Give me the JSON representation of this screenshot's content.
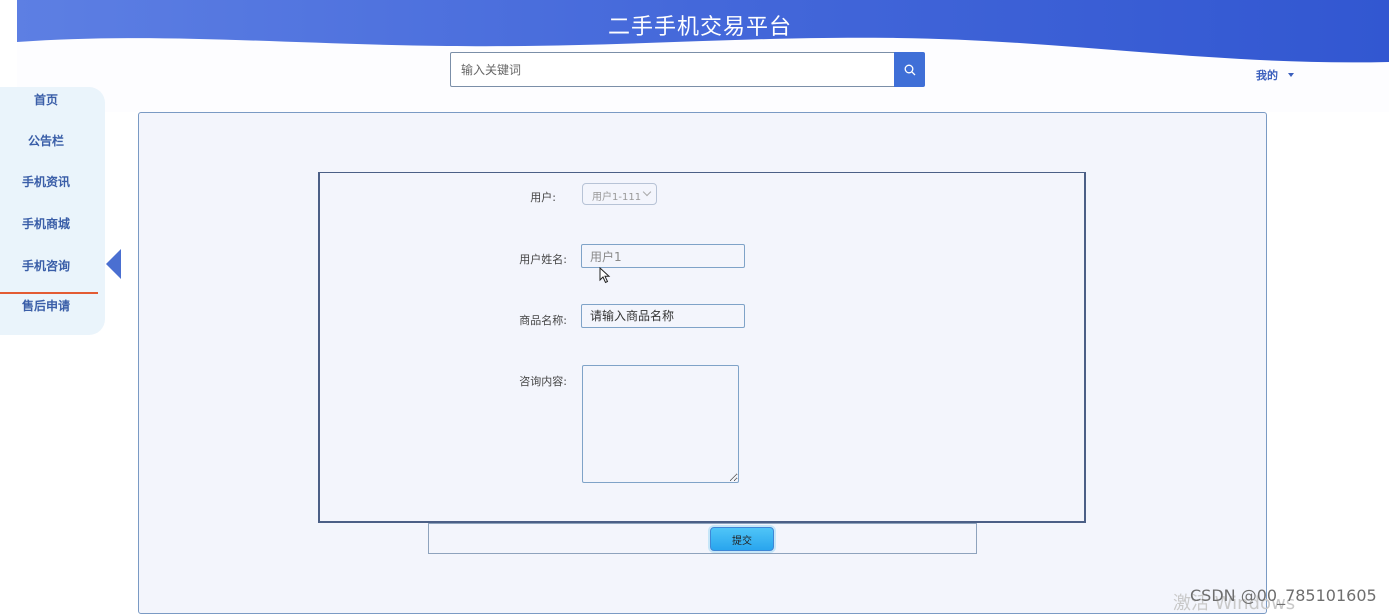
{
  "header": {
    "title": "二手手机交易平台",
    "search_placeholder": "输入关键词",
    "user_menu_label": "我的",
    "colors": {
      "wave_start": "#3a63d6",
      "wave_end": "#6f8fe8",
      "accent": "#3f6fd7"
    }
  },
  "sidebar": {
    "items": [
      {
        "label": "首页"
      },
      {
        "label": "公告栏"
      },
      {
        "label": "手机资讯"
      },
      {
        "label": "手机商城"
      },
      {
        "label": "手机咨询"
      },
      {
        "label": "售后申请"
      }
    ],
    "active_item": "售后申请"
  },
  "form": {
    "user_label": "用户:",
    "user_select_value": "用户1-111",
    "name_label": "用户姓名:",
    "name_value": "用户1",
    "product_label": "商品名称:",
    "product_placeholder": "请输入商品名称",
    "content_label": "咨询内容:",
    "content_value": "",
    "submit_label": "提交"
  },
  "watermarks": {
    "windows": "激活 Windows",
    "csdn": "CSDN @00_785101605"
  }
}
